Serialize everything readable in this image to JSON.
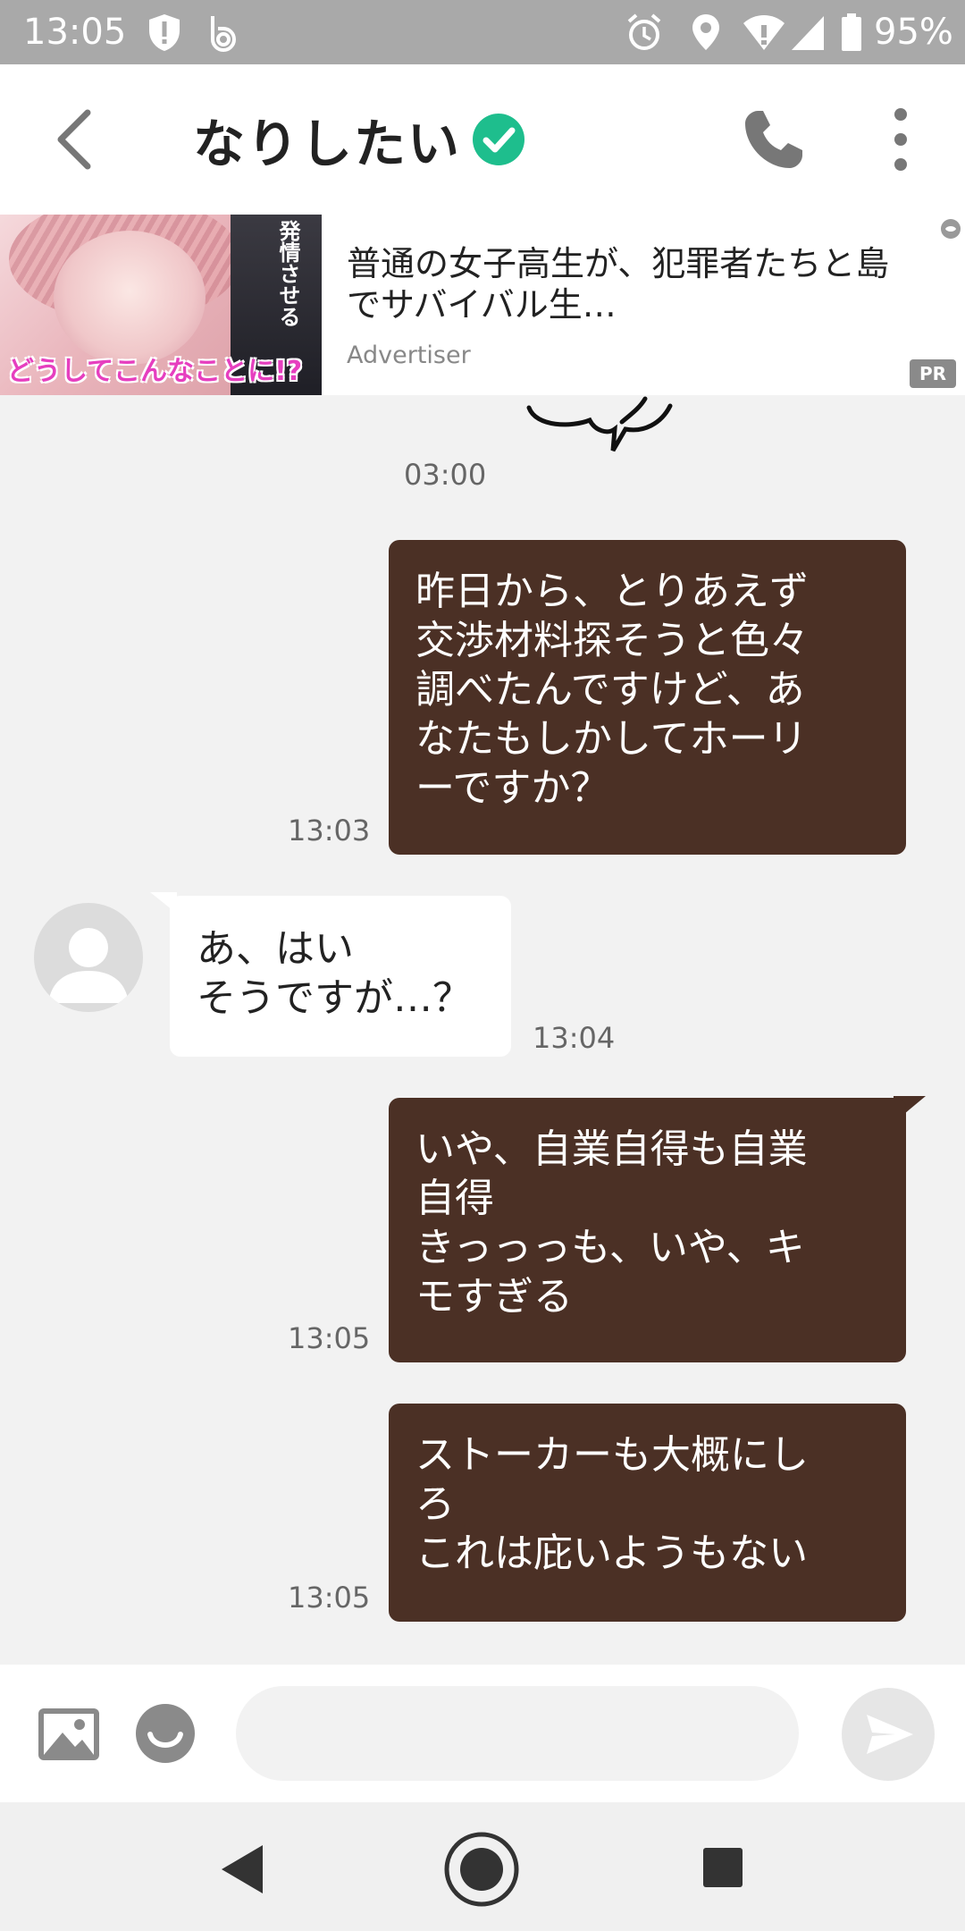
{
  "status_bar": {
    "time": "13:05",
    "battery": "95%",
    "icons": [
      "shield-alert-icon",
      "b-app-icon",
      "alarm-icon",
      "location-icon",
      "wifi-icon",
      "signal-icon",
      "battery-icon"
    ]
  },
  "header": {
    "title": "なりしたい",
    "verified_color": "#1ebe8d",
    "icons": [
      "back-chevron-icon",
      "verified-check-icon",
      "phone-icon",
      "more-vertical-icon"
    ]
  },
  "ad": {
    "title": "普通の女子高生が、犯罪者たちと島でサバイバル生…",
    "advertiser": "Advertiser",
    "badge": "PR",
    "image_overlay_text": "どうしてこんなことに!?",
    "image_side_text": "発情させる"
  },
  "chat": {
    "outgoing_color": "#4b3025",
    "messages": [
      {
        "type": "timestamp",
        "time": "03:00"
      },
      {
        "direction": "out",
        "time": "13:03",
        "lines": [
          "昨日から、とりあえず",
          "交渉材料探そうと色々",
          "調べたんですけど、あ",
          "なたもしかしてホーリ",
          "ーですか？"
        ]
      },
      {
        "direction": "in",
        "time": "13:04",
        "lines": [
          "あ、はい",
          "そうですが…？"
        ]
      },
      {
        "direction": "out",
        "time": "13:05",
        "lines": [
          "いや、自業自得も自業",
          "自得",
          "きっっっも、いや、キ",
          "モすぎる"
        ]
      },
      {
        "direction": "out",
        "time": "13:05",
        "lines": [
          "ストーカーも大概にし",
          "ろ",
          "これは庇いようもない"
        ]
      }
    ]
  },
  "input_bar": {
    "placeholder": "",
    "icons": [
      "image-icon",
      "emoji-icon",
      "send-icon"
    ]
  },
  "nav_bar": {
    "icons": [
      "nav-back-icon",
      "nav-home-icon",
      "nav-recents-icon"
    ]
  }
}
